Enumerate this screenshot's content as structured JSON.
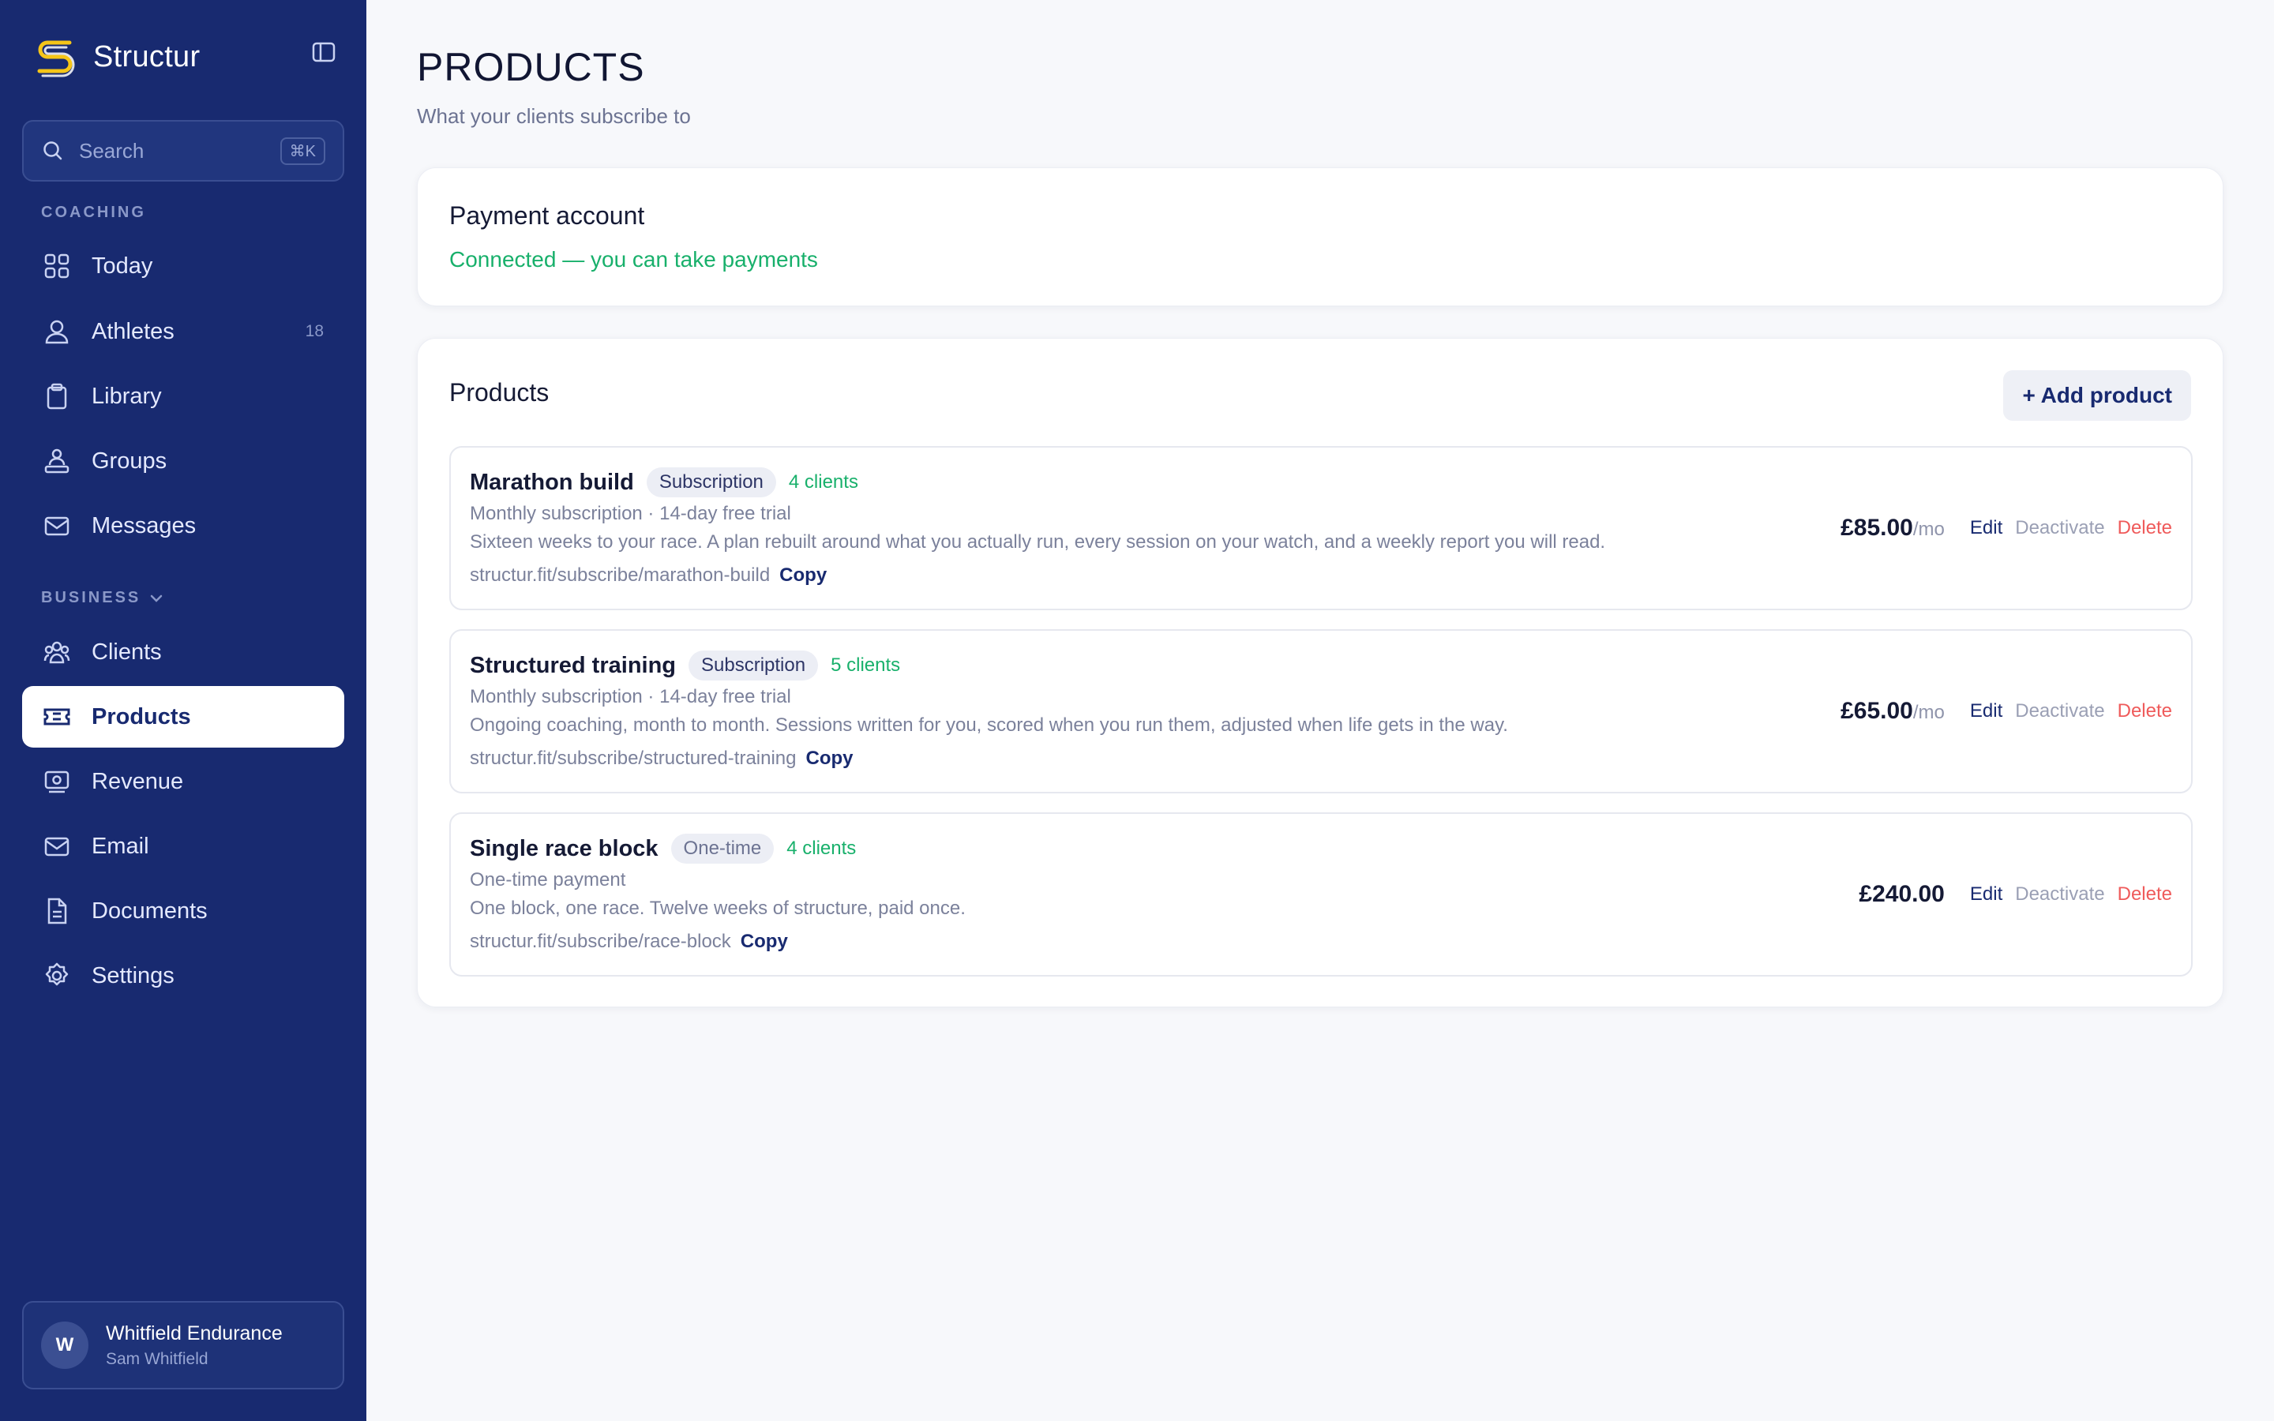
{
  "brand": {
    "name": "Structur"
  },
  "search": {
    "placeholder": "Search",
    "shortcut": "⌘K"
  },
  "sidebar": {
    "coaching_label": "COACHING",
    "business_label": "BUSINESS",
    "coaching_items": [
      {
        "label": "Today",
        "icon": "grid-icon"
      },
      {
        "label": "Athletes",
        "icon": "users-icon",
        "count": "18"
      },
      {
        "label": "Library",
        "icon": "clipboard-icon"
      },
      {
        "label": "Groups",
        "icon": "groups-icon"
      },
      {
        "label": "Messages",
        "icon": "mail-icon"
      }
    ],
    "business_items": [
      {
        "label": "Clients",
        "icon": "clients-icon"
      },
      {
        "label": "Products",
        "icon": "ticket-icon",
        "active": true
      },
      {
        "label": "Revenue",
        "icon": "revenue-icon"
      },
      {
        "label": "Email",
        "icon": "mail-icon"
      },
      {
        "label": "Documents",
        "icon": "document-icon"
      },
      {
        "label": "Settings",
        "icon": "gear-icon"
      }
    ]
  },
  "user": {
    "initial": "W",
    "name": "Whitfield Endurance",
    "sub": "Sam Whitfield"
  },
  "page": {
    "title": "PRODUCTS",
    "subtitle": "What your clients subscribe to"
  },
  "payment": {
    "title": "Payment account",
    "status": "Connected — you can take payments"
  },
  "products_card": {
    "title": "Products",
    "add_label": "+ Add product"
  },
  "products": [
    {
      "name": "Marathon build",
      "badge": "Subscription",
      "clients": "4 clients",
      "meta": "Monthly subscription · 14-day free trial",
      "description": "Sixteen weeks to your race. A plan rebuilt around what you actually run, every session on your watch, and a weekly report you will read.",
      "link": "structur.fit/subscribe/marathon-build",
      "copy": "Copy",
      "price": "£85.00",
      "unit": "/mo",
      "edit": "Edit",
      "deactivate": "Deactivate",
      "delete": "Delete"
    },
    {
      "name": "Structured training",
      "badge": "Subscription",
      "clients": "5 clients",
      "meta": "Monthly subscription · 14-day free trial",
      "description": "Ongoing coaching, month to month. Sessions written for you, scored when you run them, adjusted when life gets in the way.",
      "link": "structur.fit/subscribe/structured-training",
      "copy": "Copy",
      "price": "£65.00",
      "unit": "/mo",
      "edit": "Edit",
      "deactivate": "Deactivate",
      "delete": "Delete"
    },
    {
      "name": "Single race block",
      "badge": "One-time",
      "clients": "4 clients",
      "meta": "One-time payment",
      "description": "One block, one race. Twelve weeks of structure, paid once.",
      "link": "structur.fit/subscribe/race-block",
      "copy": "Copy",
      "price": "£240.00",
      "unit": "",
      "edit": "Edit",
      "deactivate": "Deactivate",
      "delete": "Delete"
    }
  ],
  "colors": {
    "sidebar_bg": "#182a70",
    "accent_green": "#18b06b",
    "delete_red": "#ef5a5a",
    "brand_yellow": "#f5c518"
  }
}
